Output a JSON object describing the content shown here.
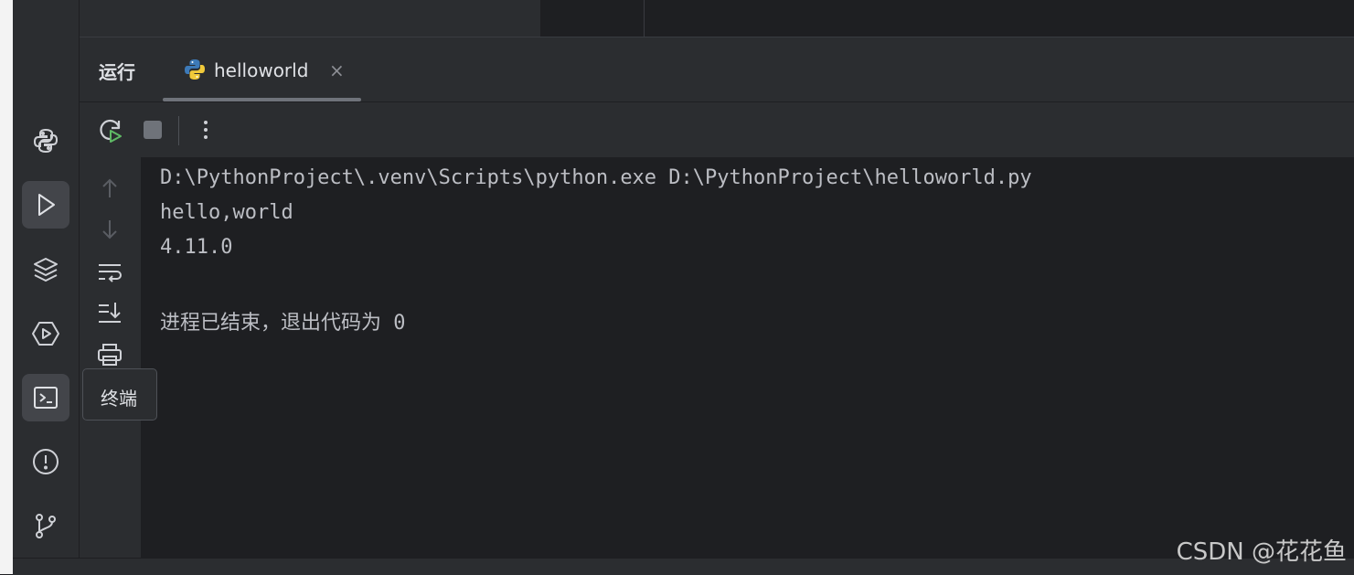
{
  "panel": {
    "title": "运行"
  },
  "run_tab": {
    "label": "helloworld",
    "close": "×",
    "icon": "python-icon"
  },
  "toolbar": {
    "rerun_icon": "rerun-icon",
    "stop_icon": "stop-icon",
    "more": "⋮"
  },
  "side_tools": [
    "arrow-up-icon",
    "arrow-down-icon",
    "soft-wrap-icon",
    "scroll-to-end-icon",
    "print-icon"
  ],
  "activity_bar": {
    "items": [
      "python-packages-icon",
      "run-icon",
      "layers-icon",
      "services-icon",
      "terminal-icon",
      "problems-icon",
      "git-icon"
    ],
    "active": [
      "run-icon",
      "terminal-icon"
    ]
  },
  "console": {
    "lines": [
      "D:\\PythonProject\\.venv\\Scripts\\python.exe D:\\PythonProject\\helloworld.py",
      "hello,world",
      "4.11.0",
      "",
      "进程已结束，退出代码为 0"
    ]
  },
  "tooltip": {
    "text": "终端"
  },
  "watermark": "CSDN @花花鱼",
  "colors": {
    "bg": "#1e1f22",
    "panel": "#2b2d30",
    "accent_green": "#5fb865"
  }
}
